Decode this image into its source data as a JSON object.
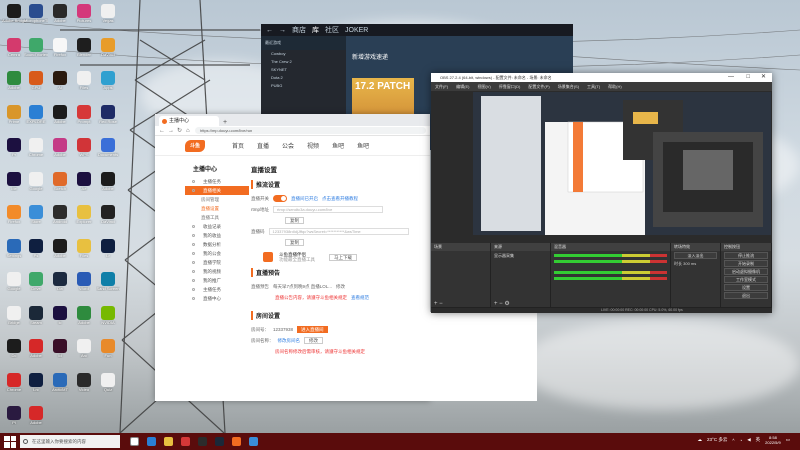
{
  "desktop": {
    "icons": [
      {
        "label": "Adobe Bridge",
        "color": "#1c1c1c"
      },
      {
        "label": "MicrophoneThe",
        "color": "#2a4d8f"
      },
      {
        "label": "Adobe",
        "color": "#2a2a2a"
      },
      {
        "label": "Pictures",
        "color": "#d4387b"
      },
      {
        "label": "Vegas",
        "color": "#f0f0f0"
      },
      {
        "label": "Cemra",
        "color": "#d43a6d"
      },
      {
        "label": "Sound Vortex",
        "color": "#3fa86a"
      },
      {
        "label": "Firefox",
        "color": "#f7f7f7"
      },
      {
        "label": "Blender",
        "color": "#1e1e1e"
      },
      {
        "label": "DaVinci",
        "color": "#e89c2a"
      },
      {
        "label": "Adobe",
        "color": "#2e8b3e"
      },
      {
        "label": "GPU",
        "color": "#d85a1a"
      },
      {
        "label": "Ai",
        "color": "#2a1a0f"
      },
      {
        "label": "Files",
        "color": "#f0f0f0"
      },
      {
        "label": "Apps",
        "color": "#30a0d0"
      },
      {
        "label": "Prime",
        "color": "#d9962a"
      },
      {
        "label": "EXPLORE",
        "color": "#2a7fd4"
      },
      {
        "label": "Adobe",
        "color": "#1c1c1c"
      },
      {
        "label": "Prompt",
        "color": "#d63838"
      },
      {
        "label": "Red Rose",
        "color": "#1e2b66"
      },
      {
        "label": "Pr",
        "color": "#1c1040"
      },
      {
        "label": "Chrome",
        "color": "#f0f0f0"
      },
      {
        "label": "Adobe",
        "color": "#c43b86"
      },
      {
        "label": "WPS",
        "color": "#d13438"
      },
      {
        "label": "Documents",
        "color": "#3a6fd8"
      },
      {
        "label": "Me",
        "color": "#1c1040"
      },
      {
        "label": "Google",
        "color": "#f0f0f0"
      },
      {
        "label": "Sketch",
        "color": "#e06a2a"
      },
      {
        "label": "Ae",
        "color": "#1c1040"
      },
      {
        "label": "Adobe",
        "color": "#1c1c1c"
      },
      {
        "label": "Firefox",
        "color": "#f28b2a"
      },
      {
        "label": "Store",
        "color": "#3a8ed8"
      },
      {
        "label": "Android",
        "color": "#2c2c2c"
      },
      {
        "label": "Explorer",
        "color": "#e8c040"
      },
      {
        "label": "DaVinci",
        "color": "#222"
      },
      {
        "label": "Settings",
        "color": "#2a6ab8"
      },
      {
        "label": "Ps",
        "color": "#0f1f40"
      },
      {
        "label": "Adobe",
        "color": "#1c1c1c"
      },
      {
        "label": "Files",
        "color": "#e8c040"
      },
      {
        "label": "Lr",
        "color": "#0f1f40"
      },
      {
        "label": "Google",
        "color": "#f0f0f0"
      },
      {
        "label": "Drive",
        "color": "#3fa86a"
      },
      {
        "label": "Dw",
        "color": "#1c2a40"
      },
      {
        "label": "Word",
        "color": "#2a5bb5"
      },
      {
        "label": "Sand Screen",
        "color": "#0f7fa8"
      },
      {
        "label": "Bridge",
        "color": "#f0f0f0"
      },
      {
        "label": "Steam",
        "color": "#1b2838"
      },
      {
        "label": "Ic",
        "color": "#1c1040"
      },
      {
        "label": "Adobe",
        "color": "#2e8b3e"
      },
      {
        "label": "NVIDIA",
        "color": "#76b900"
      },
      {
        "label": "Dc",
        "color": "#1c1c1c"
      },
      {
        "label": "Adobe",
        "color": "#d62828"
      },
      {
        "label": "Id",
        "color": "#3a0f28"
      },
      {
        "label": "Arc",
        "color": "#f0f0f0"
      },
      {
        "label": "Fun",
        "color": "#e88a2a"
      },
      {
        "label": "Chrome",
        "color": "#d62828"
      },
      {
        "label": "Lrc",
        "color": "#0f1f40"
      },
      {
        "label": "ArcticMT",
        "color": "#2a6ab8"
      },
      {
        "label": "Video",
        "color": "#2a2a2a"
      },
      {
        "label": "Quiz",
        "color": "#f0f0f0"
      },
      {
        "label": "Pl",
        "color": "#2a1a40"
      },
      {
        "label": "Adobe",
        "color": "#d62828"
      }
    ]
  },
  "browser": {
    "tab_title": "主播中心",
    "url": "https://mp.douyu.com/live/run",
    "logo_text": "斗鱼",
    "nav": [
      "首页",
      "直播",
      "公会",
      "视频",
      "鱼吧",
      "鱼吧"
    ],
    "sidebar_title": "主播中心",
    "sidebar": [
      {
        "label": "主播任务",
        "kind": ""
      },
      {
        "label": "直播相关",
        "kind": "active"
      },
      {
        "label": "房间管理",
        "kind": "subg"
      },
      {
        "label": "直播设置",
        "kind": "sub"
      },
      {
        "label": "直播工具",
        "kind": "subg"
      },
      {
        "label": "收益记录",
        "kind": ""
      },
      {
        "label": "我的收益",
        "kind": ""
      },
      {
        "label": "数据分析",
        "kind": ""
      },
      {
        "label": "我的公会",
        "kind": ""
      },
      {
        "label": "直播学院",
        "kind": ""
      },
      {
        "label": "我的视频",
        "kind": ""
      },
      {
        "label": "我的推广",
        "kind": ""
      },
      {
        "label": "主播任务",
        "kind": ""
      },
      {
        "label": "直播中心",
        "kind": ""
      }
    ],
    "page_title": "直播设置",
    "section_push": "推流设置",
    "live_switch": "直播开关",
    "live_text": "直播间已开启",
    "live_help": "点击查看开播教程",
    "rtmp_label": "rtmp地址",
    "rtmp_value": "rtmp://sendtc3a.douyu.com/live",
    "copy": "复制",
    "code_label": "直播码",
    "code_value": "12337938rdldjJffqc?wsSecret=***********&wsTime",
    "copy2": "复制",
    "tool_title": "斗鱼直播伴侣",
    "tool_sub": "功能最全直播工具",
    "tool_btn": "马上下载",
    "section_notice": "直播预告",
    "notice_label": "直播预告",
    "notice_value": "每天早7点到晚9点 直播LOL...",
    "edit": "修改",
    "notice_warn": "直播公告内容，请遵守斗鱼相关规定",
    "notice_link": "查看规范",
    "section_room": "房间设置",
    "room_label": "房间号：",
    "room_value": "12337938",
    "room_btn": "进入直播间",
    "room_name_label": "房间名称：",
    "room_name_value": "修改房间名",
    "room_name_edit": "修改",
    "room_warn": "房间名称修改后需审核，请遵守斗鱼相关规定"
  },
  "steam": {
    "nav": [
      "商店",
      "库",
      "社区",
      "JOKER"
    ],
    "selected": "库",
    "filter": "最近游戏",
    "games": [
      "Cowboy",
      "The Crew 2",
      "SKYNET",
      "Dota 2",
      "PUBG"
    ],
    "main_title": "新增游戏速递",
    "patch_label": "17.2 PATCH"
  },
  "obs": {
    "title": "OBS 27.2.4 (64-bit, windows) - 配置文件: 未命名 - 场景: 未命名",
    "menu": [
      "文件(F)",
      "编辑(E)",
      "视图(V)",
      "停靠窗口(D)",
      "配置文件(P)",
      "场景集合(S)",
      "工具(T)",
      "帮助(H)"
    ],
    "dock_scenes": "场景",
    "dock_sources": "来源",
    "source_item": "显示器采集",
    "dock_mixer": "混音器",
    "dock_transitions": "转场特效",
    "transition_value": "淡入淡出",
    "duration_label": "时长",
    "duration_value": "300 ms",
    "dock_controls": "控制按钮",
    "controls": [
      "停止推流",
      "开始录制",
      "启动虚拟摄像机",
      "工作室模式",
      "设置",
      "退出"
    ],
    "status": "LIVE: 00:00:00   REC: 00:00:00   CPU: 5.0%, 60.00 fps"
  },
  "taskbar": {
    "search_placeholder": "在这里输入你要搜索的内容",
    "weather": "23°C 多云",
    "lang": "英",
    "time": "8:58",
    "date": "2022/5/9"
  }
}
